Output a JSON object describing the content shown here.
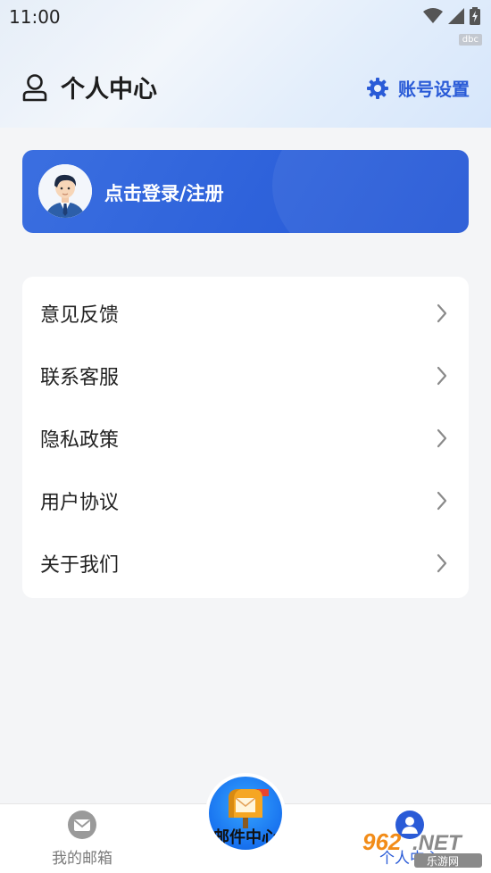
{
  "status_bar": {
    "time": "11:00",
    "tag": "dbc"
  },
  "header": {
    "title": "个人中心",
    "settings_label": "账号设置"
  },
  "login": {
    "label": "点击登录/注册"
  },
  "menu": {
    "items": [
      {
        "label": "意见反馈"
      },
      {
        "label": "联系客服"
      },
      {
        "label": "隐私政策"
      },
      {
        "label": "用户协议"
      },
      {
        "label": "关于我们"
      }
    ]
  },
  "tabbar": {
    "items": [
      {
        "label": "我的邮箱",
        "icon": "mail-icon"
      },
      {
        "label": "邮件中心",
        "icon": "mailbox-icon"
      },
      {
        "label": "个人中心",
        "icon": "user-icon"
      }
    ]
  },
  "watermark": {
    "text": "962.NET",
    "subtext": "乐游网"
  },
  "colors": {
    "accent": "#2a5bd7",
    "card_blue": "#2f63db",
    "background": "#f4f5f7"
  }
}
